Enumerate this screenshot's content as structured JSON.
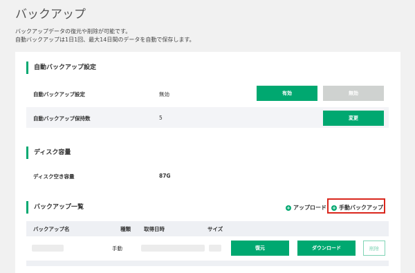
{
  "page": {
    "title": "バックアップ",
    "desc1": "バックアップデータの復元や削除が可能です。",
    "desc2": "自動バックアップは1日1回、最大14日間のデータを自動で保存します。"
  },
  "auto_backup": {
    "heading": "自動バックアップ設定",
    "setting_label": "自動バックアップ設定",
    "setting_value": "無効",
    "enable_label": "有効",
    "disable_label": "無効",
    "retention_label": "自動バックアップ保持数",
    "retention_value": "5",
    "change_label": "変更"
  },
  "disk": {
    "heading": "ディスク容量",
    "free_label": "ディスク空き容量",
    "free_value": "87G"
  },
  "list": {
    "heading": "バックアップ一覧",
    "upload_label": "アップロード",
    "manual_label": "手動バックアップ",
    "columns": [
      "バックアップ名",
      "種類",
      "取得日時",
      "サイズ"
    ],
    "row": {
      "type": "手動",
      "restore_label": "復元",
      "download_label": "ダウンロード",
      "delete_label": "削除"
    }
  },
  "colors": {
    "accent": "#00a870",
    "highlight": "#d9261c"
  }
}
